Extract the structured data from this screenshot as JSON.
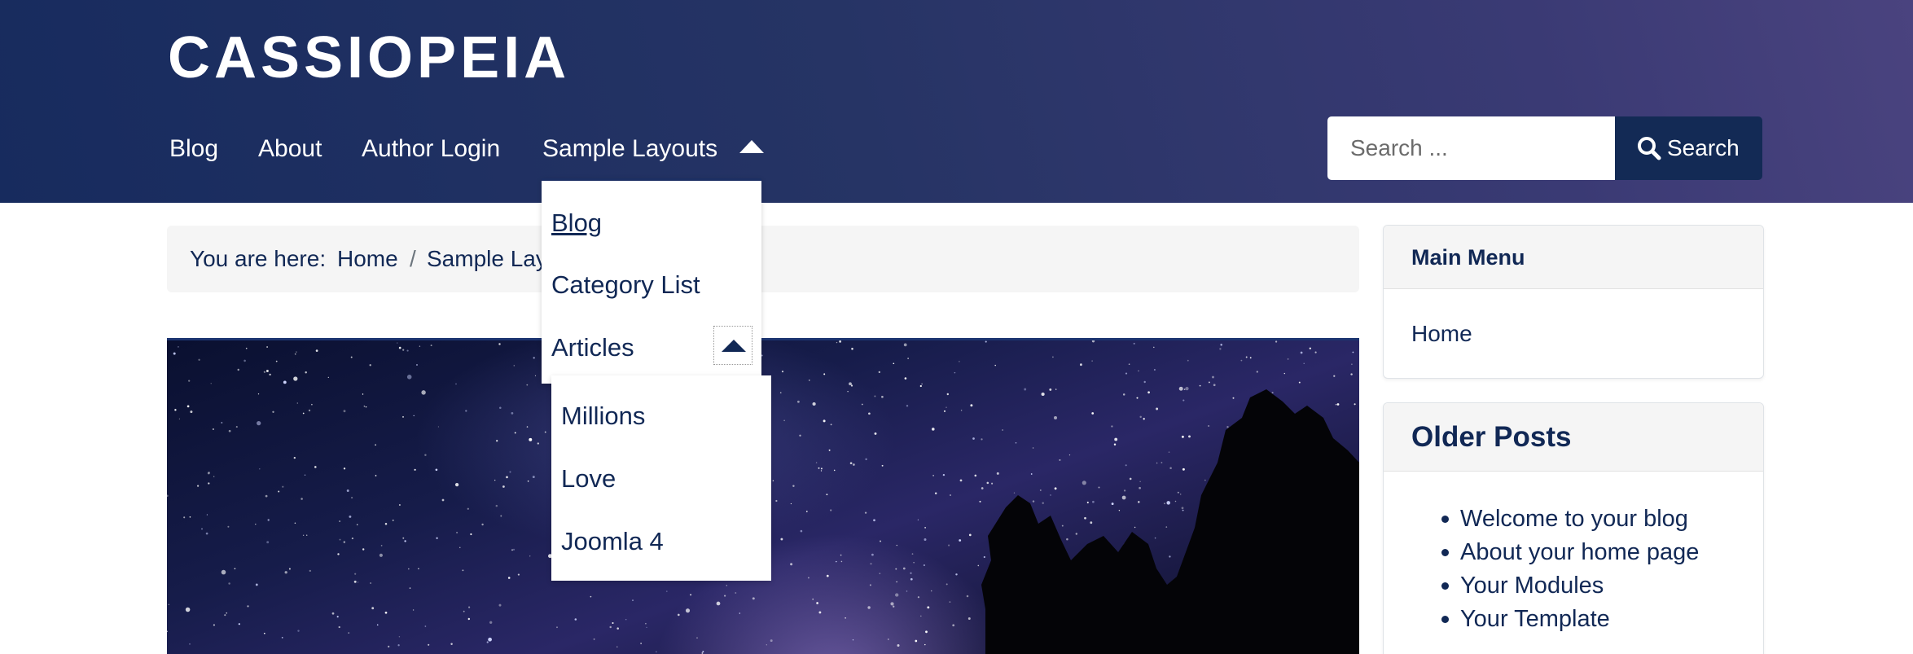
{
  "site": {
    "brand": "CASSIOPEIA"
  },
  "nav": {
    "items": [
      {
        "label": "Blog"
      },
      {
        "label": "About"
      },
      {
        "label": "Author Login"
      },
      {
        "label": "Sample Layouts"
      }
    ],
    "icons": {
      "expanded_caret": "caret-up-icon"
    }
  },
  "search": {
    "placeholder": "Search ...",
    "button_label": "Search",
    "icon": "search-icon"
  },
  "breadcrumb": {
    "prefix": "You are here:",
    "items": [
      {
        "label": "Home"
      },
      {
        "label": "Sample Layouts"
      }
    ],
    "separator": "/"
  },
  "dropdown": {
    "items": [
      {
        "label": "Blog"
      },
      {
        "label": "Category List"
      },
      {
        "label": "Articles"
      }
    ],
    "submenu": [
      {
        "label": "Millions"
      },
      {
        "label": "Love"
      },
      {
        "label": "Joomla 4"
      }
    ]
  },
  "sidebar": {
    "main_menu": {
      "title": "Main Menu",
      "items": [
        {
          "label": "Home"
        }
      ]
    },
    "older_posts": {
      "title": "Older Posts",
      "items": [
        {
          "label": "Welcome to your blog"
        },
        {
          "label": "About your home page"
        },
        {
          "label": "Your Modules"
        },
        {
          "label": "Your Template"
        }
      ]
    }
  },
  "colors": {
    "header_gradient_start": "#172b5e",
    "header_gradient_end": "#4a437f",
    "primary_text": "#112855",
    "search_button": "#132a55",
    "breadcrumb_bg": "#f5f5f5"
  }
}
